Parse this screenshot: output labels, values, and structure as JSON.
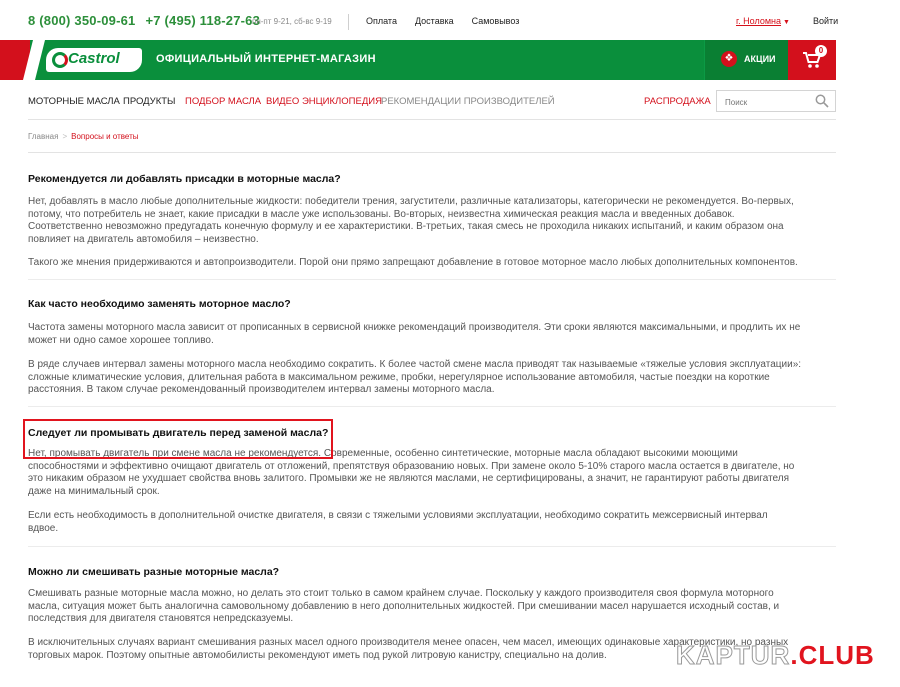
{
  "topbar": {
    "phone1": "8 (800) 350-09-61",
    "phone2": "+7 (495) 118-27-63",
    "hours": "пн-пт 9-21, сб-вс 9-19",
    "links": [
      "Оплата",
      "Доставка",
      "Самовывоз"
    ],
    "city": "г. Ноломна",
    "login": "Войти"
  },
  "header": {
    "logo_text": "Castrol",
    "store_title": "ОФИЦИАЛЬНЫЙ ИНТЕРНЕТ-МАГАЗИН",
    "promo_label": "АКЦИИ",
    "cart_count": "0"
  },
  "nav": {
    "items": [
      {
        "label": "МОТОРНЫЕ МАСЛА"
      },
      {
        "label": "ПРОДУКТЫ"
      },
      {
        "label": "ПОДБОР МАСЛА"
      },
      {
        "label": "ВИДЕО ЭНЦИКЛОПЕДИЯ"
      },
      {
        "label": "РЕКОМЕНДАЦИИ ПРОИЗВОДИТЕЛЕЙ"
      },
      {
        "label": "РАСПРОДАЖА"
      }
    ],
    "search_placeholder": "Поиск"
  },
  "breadcrumb": {
    "home": "Главная",
    "separator": ">",
    "current": "Вопросы и ответы"
  },
  "faq": [
    {
      "question": "Рекомендуется ли добавлять присадки в моторные масла?",
      "paragraphs": [
        [
          "Нет, добавлять в масло любые дополнительные жидкости: победители трения, загустители, различные катализаторы, категорически не рекомендуется. Во-первых,",
          "потому, что потребитель не знает, какие присадки в масле уже использованы. Во-вторых, неизвестна химическая реакция масла и введенных добавок.",
          "Соответственно невозможно предугадать конечную формулу и ее характеристики. В-третьих, такая смесь не проходила никаких испытаний, и каким образом она",
          "повлияет на двигатель автомобиля – неизвестно."
        ],
        [
          "Такого же мнения придерживаются и автопроизводители. Порой они прямо запрещают добавление в готовое моторное масло любых дополнительных компонентов."
        ]
      ]
    },
    {
      "question": "Как часто необходимо заменять моторное масло?",
      "paragraphs": [
        [
          "Частота замены моторного масла зависит от прописанных в сервисной книжке рекомендаций производителя. Эти сроки являются максимальными, и продлить их не",
          "может ни одно самое хорошее топливо."
        ],
        [
          "В ряде случаев интервал замены моторного масла необходимо сократить. К более частой смене масла приводят так называемые «тяжелые условия эксплуатации»:",
          "сложные климатические условия, длительная работа в максимальном режиме, пробки, нерегулярное использование автомобиля, частые поездки на короткие",
          "расстояния. В таком случае рекомендованный производителем интервал замены моторного масла."
        ]
      ]
    },
    {
      "question": "Следует ли промывать двигатель перед заменой масла?",
      "paragraphs": [
        [
          "Нет, промывать двигатель при смене масла не рекомендуется. Современные, особенно синтетические, моторные масла обладают высокими моющими",
          "способностями и эффективно очищают двигатель от отложений, препятствуя образованию новых. При замене около 5-10% старого масла остается в двигателе, но",
          "это никаким образом не ухудшает свойства вновь залитого. Промывки же не являются маслами, не сертифицированы, а значит, не гарантируют работы двигателя",
          "даже на минимальный срок."
        ],
        [
          "Если есть необходимость в дополнительной очистке двигателя, в связи с тяжелыми условиями эксплуатации, необходимо сократить межсервисный интервал",
          "вдвое."
        ]
      ]
    },
    {
      "question": "Можно ли смешивать разные моторные масла?",
      "paragraphs": [
        [
          "Смешивать разные моторные масла можно, но делать это стоит только в самом крайнем случае. Поскольку у каждого производителя своя формула моторного",
          "масла, ситуация может быть аналогична самовольному добавлению в него дополнительных жидкостей. При смешивании масел нарушается исходный состав, и",
          "последствия для двигателя становятся непредсказуемы."
        ],
        [
          "В исключительных случаях вариант смешивания разных масел одного производителя менее опасен, чем масел, имеющих одинаковые характеристики, но разных",
          "торговых марок. Поэтому опытные автомобилисты рекомендуют иметь под рукой литровую канистру, специально на долив."
        ]
      ]
    }
  ],
  "watermark": {
    "part1": "KAPTUR",
    "dot": ".",
    "part2": "CLUB"
  }
}
